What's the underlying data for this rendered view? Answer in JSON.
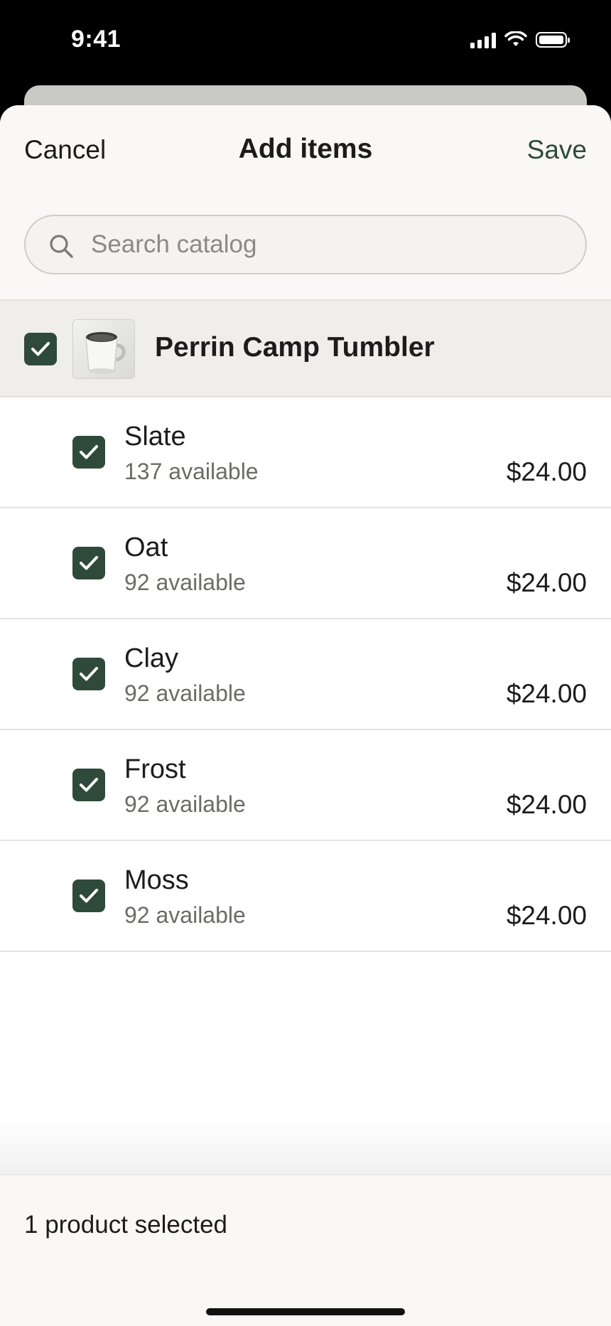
{
  "status_bar": {
    "time": "9:41"
  },
  "nav": {
    "cancel_label": "Cancel",
    "title": "Add items",
    "save_label": "Save"
  },
  "search": {
    "placeholder": "Search catalog",
    "value": ""
  },
  "product": {
    "name": "Perrin Camp Tumbler",
    "checked": true,
    "thumbnail_icon": "mug-thumbnail"
  },
  "variants": [
    {
      "name": "Slate",
      "availability": "137 available",
      "price": "$24.00",
      "checked": true
    },
    {
      "name": "Oat",
      "availability": "92 available",
      "price": "$24.00",
      "checked": true
    },
    {
      "name": "Clay",
      "availability": "92 available",
      "price": "$24.00",
      "checked": true
    },
    {
      "name": "Frost",
      "availability": "92 available",
      "price": "$24.00",
      "checked": true
    },
    {
      "name": "Moss",
      "availability": "92 available",
      "price": "$24.00",
      "checked": true
    }
  ],
  "footer": {
    "selection_text": "1 product selected"
  },
  "colors": {
    "accent": "#2f4a3b",
    "sheet_header_bg": "#f9f8f6",
    "product_row_bg": "#efeeeb"
  }
}
